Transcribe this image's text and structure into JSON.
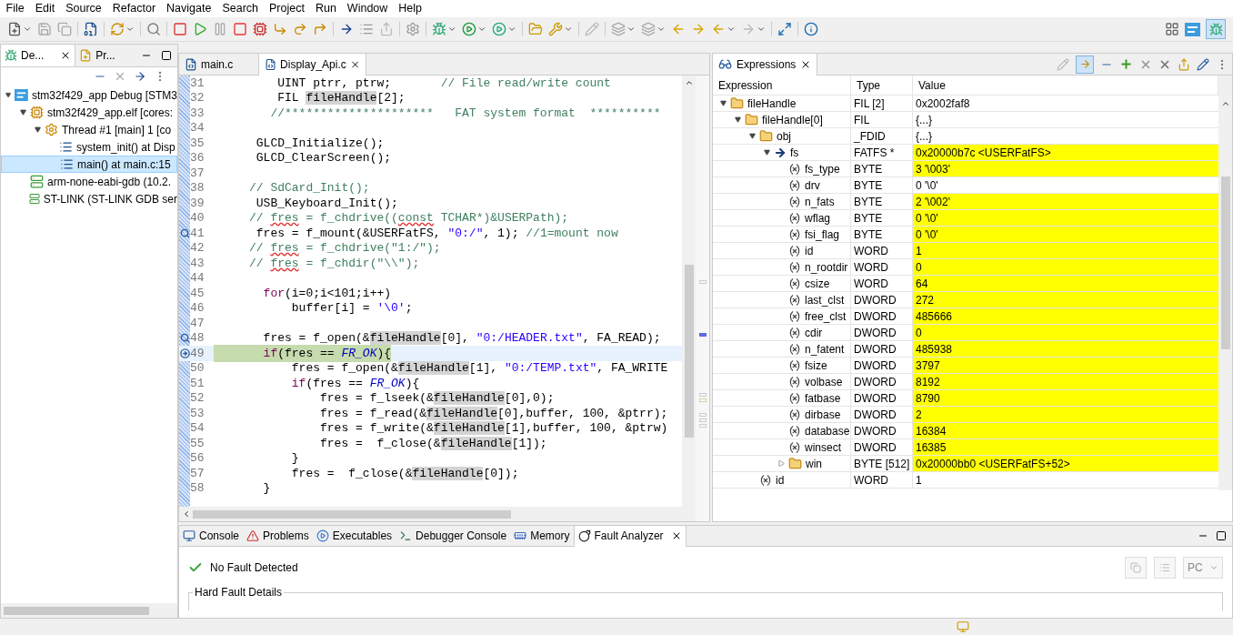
{
  "menu": [
    "File",
    "Edit",
    "Source",
    "Refactor",
    "Navigate",
    "Search",
    "Project",
    "Run",
    "Window",
    "Help"
  ],
  "debug_view": {
    "tabs": [
      {
        "label": "De...",
        "selected": true,
        "kind": "debug"
      },
      {
        "label": "Pr...",
        "selected": false,
        "kind": "project"
      }
    ],
    "tree": [
      {
        "label": "stm32f429_app Debug [STM3",
        "kind": "launch",
        "expanded": true,
        "selected": false,
        "children": [
          {
            "label": "stm32f429_app.elf [cores:",
            "kind": "process",
            "expanded": true,
            "selected": false,
            "children": [
              {
                "label": "Thread #1 [main] 1 [co",
                "kind": "thread",
                "expanded": true,
                "selected": false,
                "children": [
                  {
                    "label": "system_init() at Disp",
                    "kind": "frame",
                    "selected": false
                  },
                  {
                    "label": "main() at main.c:15",
                    "kind": "frame",
                    "selected": true
                  }
                ]
              }
            ]
          },
          {
            "label": "arm-none-eabi-gdb (10.2.",
            "kind": "server",
            "selected": false
          },
          {
            "label": "ST-LINK (ST-LINK GDB ser",
            "kind": "server",
            "selected": false
          }
        ]
      }
    ]
  },
  "editor": {
    "tabs": [
      {
        "label": "main.c",
        "selected": false
      },
      {
        "label": "Display_Api.c",
        "selected": true
      }
    ],
    "lines": [
      {
        "number": "31",
        "segments": [
          {
            "kind": "text",
            "text": "         UINT ptrr, ptrw;       "
          },
          {
            "kind": "comment",
            "text": "// File read/write count"
          }
        ]
      },
      {
        "number": "32",
        "segments": [
          {
            "kind": "text",
            "text": "         FIL "
          },
          {
            "kind": "occurrence",
            "text": "fileHandle"
          },
          {
            "kind": "text",
            "text": "[2];"
          }
        ]
      },
      {
        "number": "33",
        "segments": [
          {
            "kind": "comment",
            "text": "        //*********************   FAT system format  **********"
          }
        ]
      },
      {
        "number": "34"
      },
      {
        "number": "35",
        "segments": [
          {
            "kind": "text",
            "text": "      GLCD_Initialize();"
          }
        ]
      },
      {
        "number": "36",
        "segments": [
          {
            "kind": "text",
            "text": "      GLCD_ClearScreen();"
          }
        ]
      },
      {
        "number": "37"
      },
      {
        "number": "38",
        "segments": [
          {
            "kind": "comment",
            "text": "     // SdCard_Init();"
          }
        ]
      },
      {
        "number": "39",
        "segments": [
          {
            "kind": "text",
            "text": "      USB_Keyboard_Init();"
          }
        ]
      },
      {
        "number": "40",
        "segments": [
          {
            "kind": "comment",
            "text": "     // "
          },
          {
            "kind": "misspelled",
            "text": "fres"
          },
          {
            "kind": "comment",
            "text": " = f_chdrive(("
          },
          {
            "kind": "misspelled",
            "text": "const"
          },
          {
            "kind": "comment",
            "text": " TCHAR*)&USERPath);"
          }
        ]
      },
      {
        "number": "41",
        "tracepoint": true,
        "segments": [
          {
            "kind": "text",
            "text": "      fres = f_mount(&USERFatFS, "
          },
          {
            "kind": "string",
            "text": "\"0:/\""
          },
          {
            "kind": "text",
            "text": ", 1); "
          },
          {
            "kind": "comment",
            "text": "//1=mount now"
          }
        ]
      },
      {
        "number": "42",
        "segments": [
          {
            "kind": "comment",
            "text": "     // "
          },
          {
            "kind": "misspelled",
            "text": "fres"
          },
          {
            "kind": "comment",
            "text": " = f_chdrive(\"1:/\");"
          }
        ]
      },
      {
        "number": "43",
        "segments": [
          {
            "kind": "comment",
            "text": "     // "
          },
          {
            "kind": "misspelled",
            "text": "fres"
          },
          {
            "kind": "comment",
            "text": " = f_chdir(\"\\\\\");"
          }
        ]
      },
      {
        "number": "44"
      },
      {
        "number": "45",
        "segments": [
          {
            "kind": "keyword",
            "text": "       for"
          },
          {
            "kind": "text",
            "text": "(i=0;i<101;i++)"
          }
        ]
      },
      {
        "number": "46",
        "segments": [
          {
            "kind": "text",
            "text": "           buffer[i] = "
          },
          {
            "kind": "string",
            "text": "'\\0'"
          },
          {
            "kind": "text",
            "text": ";"
          }
        ]
      },
      {
        "number": "47"
      },
      {
        "number": "48",
        "tracepoint": true,
        "segments": [
          {
            "kind": "text",
            "text": "       fres = f_open(&"
          },
          {
            "kind": "occurrence",
            "text": "fileHandle"
          },
          {
            "kind": "text",
            "text": "[0], "
          },
          {
            "kind": "string",
            "text": "\"0:/HEADER.txt\""
          },
          {
            "kind": "text",
            "text": ", FA_READ);"
          }
        ]
      },
      {
        "number": "49",
        "current": true,
        "segments": [
          {
            "kind": "keyword",
            "text": "       if"
          },
          {
            "kind": "text",
            "text": "(fres == "
          },
          {
            "kind": "macro",
            "text": "FR_OK"
          },
          {
            "kind": "text",
            "text": "){"
          }
        ]
      },
      {
        "number": "50",
        "segments": [
          {
            "kind": "text",
            "text": "           fres = f_open(&"
          },
          {
            "kind": "occurrence",
            "text": "fileHandle"
          },
          {
            "kind": "text",
            "text": "[1], "
          },
          {
            "kind": "string",
            "text": "\"0:/TEMP.txt\""
          },
          {
            "kind": "text",
            "text": ", FA_WRITE"
          }
        ]
      },
      {
        "number": "51",
        "segments": [
          {
            "kind": "keyword",
            "text": "           if"
          },
          {
            "kind": "text",
            "text": "(fres == "
          },
          {
            "kind": "macro",
            "text": "FR_OK"
          },
          {
            "kind": "text",
            "text": "){"
          }
        ]
      },
      {
        "number": "52",
        "segments": [
          {
            "kind": "text",
            "text": "               fres = f_lseek(&"
          },
          {
            "kind": "occurrence",
            "text": "fileHandle"
          },
          {
            "kind": "text",
            "text": "[0],0);"
          }
        ]
      },
      {
        "number": "53",
        "segments": [
          {
            "kind": "text",
            "text": "               fres = f_read(&"
          },
          {
            "kind": "occurrence",
            "text": "fileHandle"
          },
          {
            "kind": "text",
            "text": "[0],buffer, 100, &ptrr);"
          }
        ]
      },
      {
        "number": "54",
        "segments": [
          {
            "kind": "text",
            "text": "               fres = f_write(&"
          },
          {
            "kind": "occurrence",
            "text": "fileHandle"
          },
          {
            "kind": "text",
            "text": "[1],buffer, 100, &ptrw)"
          }
        ]
      },
      {
        "number": "55",
        "segments": [
          {
            "kind": "text",
            "text": "               fres =  f_close(&"
          },
          {
            "kind": "occurrence",
            "text": "fileHandle"
          },
          {
            "kind": "text",
            "text": "[1]);"
          }
        ]
      },
      {
        "number": "56",
        "segments": [
          {
            "kind": "text",
            "text": "           }"
          }
        ]
      },
      {
        "number": "57",
        "segments": [
          {
            "kind": "text",
            "text": "           fres =  f_close(&"
          },
          {
            "kind": "occurrence",
            "text": "fileHandle"
          },
          {
            "kind": "text",
            "text": "[0]);"
          }
        ]
      },
      {
        "number": "58",
        "segments": [
          {
            "kind": "text",
            "text": "       }"
          }
        ]
      }
    ]
  },
  "expressions": {
    "tab": {
      "label": "Expressions",
      "selected": true
    },
    "columns": [
      "Expression",
      "Type",
      "Value"
    ],
    "rows": [
      {
        "name": "fileHandle",
        "type": "FIL [2]",
        "value": "0x2002faf8",
        "kind": "struct",
        "expanded": true,
        "changed": false,
        "children": [
          {
            "name": "fileHandle[0]",
            "type": "FIL",
            "value": "{...}",
            "kind": "struct",
            "expanded": true,
            "changed": false,
            "children": [
              {
                "name": "obj",
                "type": "_FDID",
                "value": "{...}",
                "kind": "struct",
                "expanded": true,
                "changed": false,
                "children": [
                  {
                    "name": "fs",
                    "type": "FATFS *",
                    "value": "0x20000b7c <USERFatFS>",
                    "kind": "pointer",
                    "expanded": true,
                    "changed": true,
                    "children": [
                      {
                        "name": "fs_type",
                        "type": "BYTE",
                        "value": "3 '\\003'",
                        "kind": "field",
                        "changed": true
                      },
                      {
                        "name": "drv",
                        "type": "BYTE",
                        "value": "0 '\\0'",
                        "kind": "field",
                        "changed": false
                      },
                      {
                        "name": "n_fats",
                        "type": "BYTE",
                        "value": "2 '\\002'",
                        "kind": "field",
                        "changed": true
                      },
                      {
                        "name": "wflag",
                        "type": "BYTE",
                        "value": "0 '\\0'",
                        "kind": "field",
                        "changed": true
                      },
                      {
                        "name": "fsi_flag",
                        "type": "BYTE",
                        "value": "0 '\\0'",
                        "kind": "field",
                        "changed": true
                      },
                      {
                        "name": "id",
                        "type": "WORD",
                        "value": "1",
                        "kind": "field",
                        "changed": true
                      },
                      {
                        "name": "n_rootdir",
                        "type": "WORD",
                        "value": "0",
                        "kind": "field",
                        "changed": true
                      },
                      {
                        "name": "csize",
                        "type": "WORD",
                        "value": "64",
                        "kind": "field",
                        "changed": true
                      },
                      {
                        "name": "last_clst",
                        "type": "DWORD",
                        "value": "272",
                        "kind": "field",
                        "changed": true
                      },
                      {
                        "name": "free_clst",
                        "type": "DWORD",
                        "value": "485666",
                        "kind": "field",
                        "changed": true
                      },
                      {
                        "name": "cdir",
                        "type": "DWORD",
                        "value": "0",
                        "kind": "field",
                        "changed": true
                      },
                      {
                        "name": "n_fatent",
                        "type": "DWORD",
                        "value": "485938",
                        "kind": "field",
                        "changed": true
                      },
                      {
                        "name": "fsize",
                        "type": "DWORD",
                        "value": "3797",
                        "kind": "field",
                        "changed": true
                      },
                      {
                        "name": "volbase",
                        "type": "DWORD",
                        "value": "8192",
                        "kind": "field",
                        "changed": true
                      },
                      {
                        "name": "fatbase",
                        "type": "DWORD",
                        "value": "8790",
                        "kind": "field",
                        "changed": true
                      },
                      {
                        "name": "dirbase",
                        "type": "DWORD",
                        "value": "2",
                        "kind": "field",
                        "changed": true
                      },
                      {
                        "name": "database",
                        "type": "DWORD",
                        "value": "16384",
                        "kind": "field",
                        "changed": true
                      },
                      {
                        "name": "winsect",
                        "type": "DWORD",
                        "value": "16385",
                        "kind": "field",
                        "changed": true
                      },
                      {
                        "name": "win",
                        "type": "BYTE [512]",
                        "value": "0x20000bb0 <USERFatFS+52>",
                        "kind": "struct",
                        "expanded": false,
                        "changed": true
                      }
                    ]
                  }
                ]
              },
              {
                "name": "id",
                "type": "WORD",
                "value": "1",
                "kind": "field",
                "changed": false
              }
            ]
          }
        ]
      }
    ]
  },
  "bottom": {
    "tabs": [
      {
        "label": "Console",
        "selected": false,
        "kind": "console"
      },
      {
        "label": "Problems",
        "selected": false,
        "kind": "problems"
      },
      {
        "label": "Executables",
        "selected": false,
        "kind": "executables"
      },
      {
        "label": "Debugger Console",
        "selected": false,
        "kind": "debugger"
      },
      {
        "label": "Memory",
        "selected": false,
        "kind": "memory"
      },
      {
        "label": "Fault Analyzer",
        "selected": true,
        "kind": "fault"
      }
    ],
    "status": "No Fault Detected",
    "group": "Hard Fault Details",
    "register_select": "PC"
  }
}
